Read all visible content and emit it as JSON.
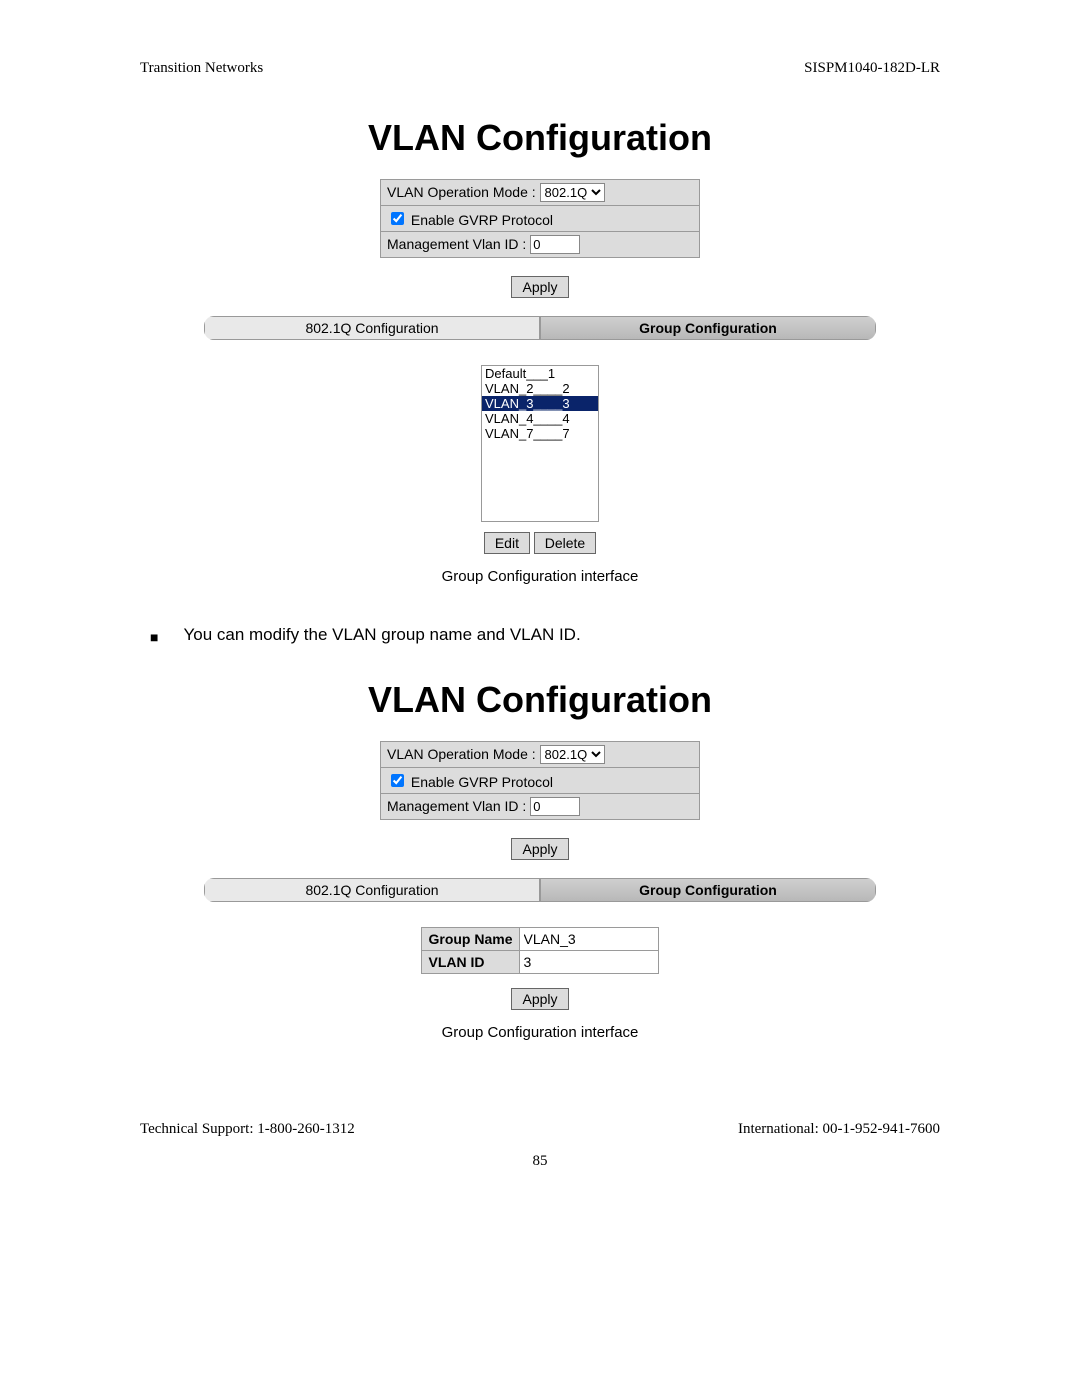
{
  "header": {
    "left": "Transition Networks",
    "right": "SISPM1040-182D-LR"
  },
  "heading": "VLAN Configuration",
  "form": {
    "mode_label": "VLAN Operation Mode : ",
    "mode_value": "802.1Q",
    "gvrp_checked": true,
    "gvrp_label": " Enable GVRP Protocol",
    "mgmt_label": "Management Vlan ID : ",
    "mgmt_value": "0",
    "apply": "Apply"
  },
  "tabs": {
    "left": "802.1Q Configuration",
    "right": "Group Configuration"
  },
  "list": {
    "items": [
      {
        "text": "Default___1",
        "sel": false
      },
      {
        "text": "VLAN_2____2",
        "sel": false
      },
      {
        "text": "VLAN_3____3",
        "sel": true
      },
      {
        "text": "VLAN_4____4",
        "sel": false
      },
      {
        "text": "VLAN_7____7",
        "sel": false
      }
    ],
    "edit": "Edit",
    "delete": "Delete"
  },
  "caption": "Group Configuration interface",
  "bullet_text": "You can modify the VLAN group name and VLAN ID.",
  "edit_form": {
    "name_label": "Group Name",
    "name_value": "VLAN_3",
    "id_label": "VLAN ID",
    "id_value": "3",
    "apply": "Apply"
  },
  "footer": {
    "left": "Technical Support: 1-800-260-1312",
    "right": "International: 00-1-952-941-7600",
    "page": "85"
  }
}
